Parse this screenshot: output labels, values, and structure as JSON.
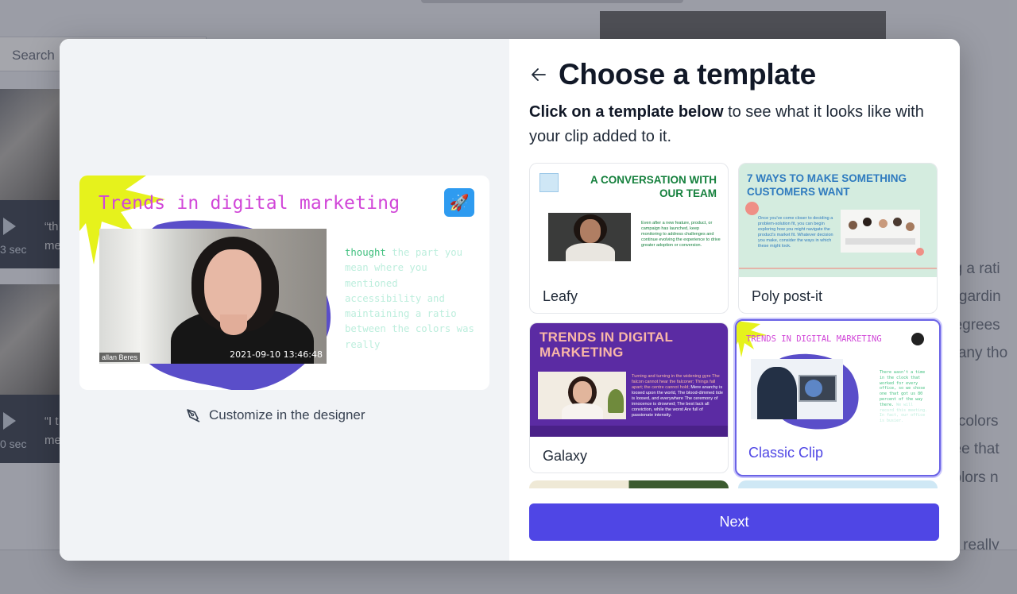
{
  "background": {
    "search_placeholder": "Search",
    "cards": [
      {
        "quote": "“th",
        "quote2": "me",
        "duration": "3 sec"
      },
      {
        "quote": "“I t",
        "quote2": "me",
        "duration": "0 sec"
      }
    ],
    "right_fragments": [
      "ng a rati",
      "regardin",
      "degrees",
      "e any tho",
      "e colors",
      "see that",
      "colors n",
      "re really"
    ]
  },
  "preview": {
    "title": "Trends in digital marketing",
    "speaker_name": "allan Beres",
    "timestamp": "2021-09-10 13:46:48",
    "transcript_highlight": "thought",
    "transcript_rest": "the part you mean where you mentioned accessibility and maintaining a ratio between the colors was really"
  },
  "customize_label": "Customize in the designer",
  "header": {
    "title": "Choose a template",
    "subtitle_bold": "Click on a template below",
    "subtitle_rest": " to see what it looks like with your clip added to it."
  },
  "templates": [
    {
      "name": "Leafy",
      "thumb_title": "A CONVERSATION WITH OUR TEAM",
      "thumb_text": "Even after a new feature, product, or campaign has launched, keep monitoring to address challenges and continue evolving the experience to drive greater adoption or conversion."
    },
    {
      "name": "Poly post-it",
      "thumb_title": "7 WAYS TO MAKE SOMETHING CUSTOMERS WANT",
      "thumb_text": "Once you've come closer to deciding a problem-solution fit, you can begin exploring how you might navigate the product's market fit. Whatever decision you make, consider the ways in which these might look."
    },
    {
      "name": "Galaxy",
      "thumb_title": "TRENDS IN DIGITAL MARKETING",
      "thumb_text_lead": "Turning and turning in the widening gyre The falcon cannot hear the falconer; Things fall apart; the centre cannot hold;",
      "thumb_text": "Mere anarchy is loosed upon the world, The blood-dimmed tide is loosed, and everywhere The ceremony of innocence is drowned; The best lack all conviction, while the worst Are full of passionate intensity."
    },
    {
      "name": "Classic Clip",
      "selected": true,
      "thumb_title": "TRENDS IN DIGITAL MARKETING",
      "thumb_text": "There wasn't a time in the clock that worked for every office, so we chose one that got us 80 percent of the way there.",
      "thumb_text_light": "We will record this meeting. In fact, our office is busier."
    }
  ],
  "next_label": "Next",
  "colors": {
    "accent": "#4f46e5",
    "magenta_title": "#d147d8",
    "burst_yellow": "#e6f21c",
    "blob_purple": "#5a4ec9",
    "leafy_green": "#15803d",
    "poly_blue": "#2f7bbf",
    "galaxy_purple": "#5b2ba3"
  }
}
